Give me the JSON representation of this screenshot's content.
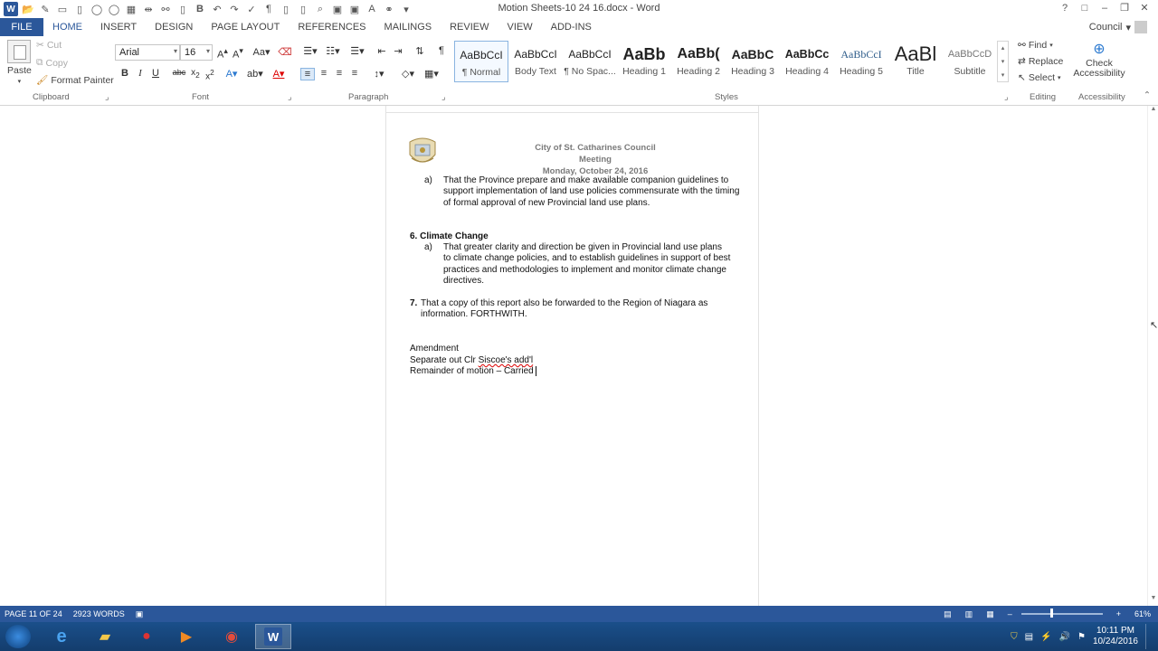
{
  "window": {
    "title": "Motion Sheets-10 24 16.docx - Word",
    "controls": [
      "?",
      "□",
      "–",
      "❐",
      "✕"
    ]
  },
  "tabs": {
    "file": "FILE",
    "items": [
      "HOME",
      "INSERT",
      "DESIGN",
      "PAGE LAYOUT",
      "REFERENCES",
      "MAILINGS",
      "REVIEW",
      "VIEW",
      "ADD-INS"
    ],
    "active": "HOME"
  },
  "user": {
    "name": "Council"
  },
  "ribbon": {
    "clipboard": {
      "paste": "Paste",
      "cut": "Cut",
      "copy": "Copy",
      "format_painter": "Format Painter",
      "label": "Clipboard"
    },
    "font": {
      "family": "Arial",
      "size": "16",
      "label": "Font"
    },
    "paragraph": {
      "label": "Paragraph"
    },
    "styles": {
      "label": "Styles",
      "items": [
        {
          "sample": "AaBbCcI",
          "name": "¶ Normal"
        },
        {
          "sample": "AaBbCcI",
          "name": "Body Text"
        },
        {
          "sample": "AaBbCcI",
          "name": "¶ No Spac..."
        },
        {
          "sample": "AaBb",
          "name": "Heading 1"
        },
        {
          "sample": "AaBb(",
          "name": "Heading 2"
        },
        {
          "sample": "AaBbC",
          "name": "Heading 3"
        },
        {
          "sample": "AaBbCc",
          "name": "Heading 4"
        },
        {
          "sample": "AaBbCcI",
          "name": "Heading 5"
        },
        {
          "sample": "AaBl",
          "name": "Title"
        },
        {
          "sample": "AaBbCcD",
          "name": "Subtitle"
        }
      ]
    },
    "editing": {
      "find": "Find",
      "replace": "Replace",
      "select": "Select",
      "label": "Editing"
    },
    "accessibility": {
      "check": "Check Accessibility",
      "label": "Accessibility"
    }
  },
  "document": {
    "header_line1": "City of St. Catharines Council Meeting",
    "header_line2": "Monday, October 24, 2016",
    "item_a1_num": "a)",
    "item_a1": "That the Province prepare and make available companion guidelines to support implementation of land use policies commensurate with the timing of formal approval of new Provincial land use plans.",
    "section6_num": "6.",
    "section6_title": "Climate Change",
    "item_a2_num": "a)",
    "item_a2": "That greater clarity and direction be given in Provincial land use plans to climate change policies, and to establish guidelines in support of best practices and methodologies to implement and monitor climate change directives.",
    "section7_num": "7.",
    "section7": "That a copy of this report also be forwarded to the Region of Niagara as information. FORTHWITH.",
    "amendment": "Amendment",
    "separate_prefix": "Separate out Clr ",
    "separate_squiggle": "Siscoe's add'l",
    "remainder": "Remainder of motion – Carried"
  },
  "status": {
    "page": "PAGE 11 OF 24",
    "words": "2923 WORDS",
    "zoom": "61%",
    "zoom_level": 0.61
  },
  "taskbar": {
    "time": "10:11 PM",
    "date": "10/24/2016"
  },
  "colors": {
    "accent": "#2b579a",
    "taskbar": "#143d6d"
  }
}
